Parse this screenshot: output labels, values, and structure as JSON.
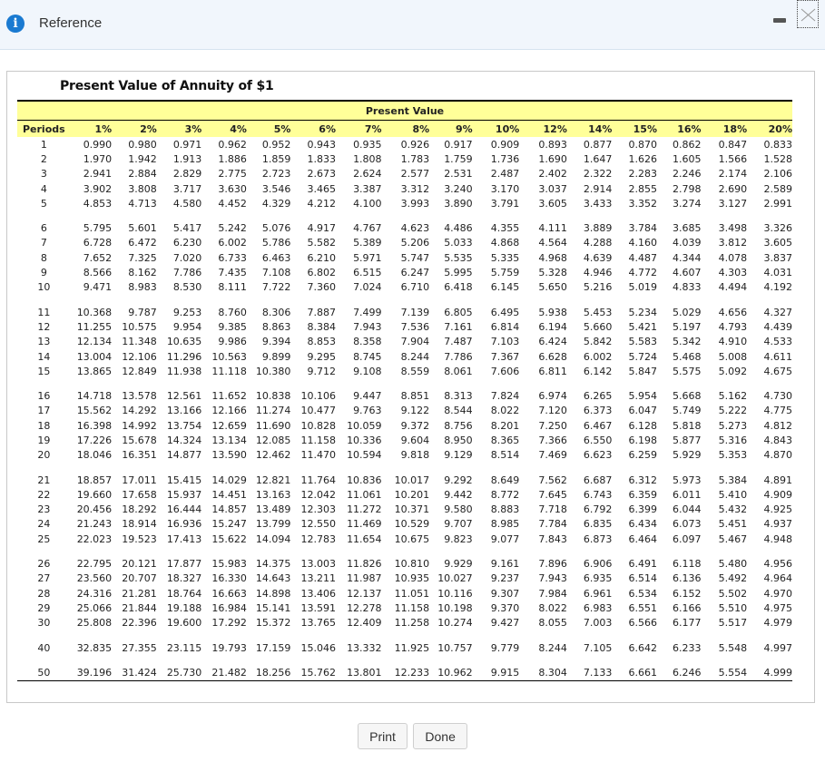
{
  "window": {
    "title": "Reference",
    "icons": {
      "info": "info-icon",
      "minimize": "minimize-icon",
      "close": "close-icon"
    }
  },
  "panel": {
    "title": "Present Value of Annuity of $1",
    "banner": "Present Value"
  },
  "table": {
    "headers": [
      "Periods",
      "1%",
      "2%",
      "3%",
      "4%",
      "5%",
      "6%",
      "7%",
      "8%",
      "9%",
      "10%",
      "12%",
      "14%",
      "15%",
      "16%",
      "18%",
      "20%"
    ],
    "groups": [
      [
        [
          "1",
          "0.990",
          "0.980",
          "0.971",
          "0.962",
          "0.952",
          "0.943",
          "0.935",
          "0.926",
          "0.917",
          "0.909",
          "0.893",
          "0.877",
          "0.870",
          "0.862",
          "0.847",
          "0.833"
        ],
        [
          "2",
          "1.970",
          "1.942",
          "1.913",
          "1.886",
          "1.859",
          "1.833",
          "1.808",
          "1.783",
          "1.759",
          "1.736",
          "1.690",
          "1.647",
          "1.626",
          "1.605",
          "1.566",
          "1.528"
        ],
        [
          "3",
          "2.941",
          "2.884",
          "2.829",
          "2.775",
          "2.723",
          "2.673",
          "2.624",
          "2.577",
          "2.531",
          "2.487",
          "2.402",
          "2.322",
          "2.283",
          "2.246",
          "2.174",
          "2.106"
        ],
        [
          "4",
          "3.902",
          "3.808",
          "3.717",
          "3.630",
          "3.546",
          "3.465",
          "3.387",
          "3.312",
          "3.240",
          "3.170",
          "3.037",
          "2.914",
          "2.855",
          "2.798",
          "2.690",
          "2.589"
        ],
        [
          "5",
          "4.853",
          "4.713",
          "4.580",
          "4.452",
          "4.329",
          "4.212",
          "4.100",
          "3.993",
          "3.890",
          "3.791",
          "3.605",
          "3.433",
          "3.352",
          "3.274",
          "3.127",
          "2.991"
        ]
      ],
      [
        [
          "6",
          "5.795",
          "5.601",
          "5.417",
          "5.242",
          "5.076",
          "4.917",
          "4.767",
          "4.623",
          "4.486",
          "4.355",
          "4.111",
          "3.889",
          "3.784",
          "3.685",
          "3.498",
          "3.326"
        ],
        [
          "7",
          "6.728",
          "6.472",
          "6.230",
          "6.002",
          "5.786",
          "5.582",
          "5.389",
          "5.206",
          "5.033",
          "4.868",
          "4.564",
          "4.288",
          "4.160",
          "4.039",
          "3.812",
          "3.605"
        ],
        [
          "8",
          "7.652",
          "7.325",
          "7.020",
          "6.733",
          "6.463",
          "6.210",
          "5.971",
          "5.747",
          "5.535",
          "5.335",
          "4.968",
          "4.639",
          "4.487",
          "4.344",
          "4.078",
          "3.837"
        ],
        [
          "9",
          "8.566",
          "8.162",
          "7.786",
          "7.435",
          "7.108",
          "6.802",
          "6.515",
          "6.247",
          "5.995",
          "5.759",
          "5.328",
          "4.946",
          "4.772",
          "4.607",
          "4.303",
          "4.031"
        ],
        [
          "10",
          "9.471",
          "8.983",
          "8.530",
          "8.111",
          "7.722",
          "7.360",
          "7.024",
          "6.710",
          "6.418",
          "6.145",
          "5.650",
          "5.216",
          "5.019",
          "4.833",
          "4.494",
          "4.192"
        ]
      ],
      [
        [
          "11",
          "10.368",
          "9.787",
          "9.253",
          "8.760",
          "8.306",
          "7.887",
          "7.499",
          "7.139",
          "6.805",
          "6.495",
          "5.938",
          "5.453",
          "5.234",
          "5.029",
          "4.656",
          "4.327"
        ],
        [
          "12",
          "11.255",
          "10.575",
          "9.954",
          "9.385",
          "8.863",
          "8.384",
          "7.943",
          "7.536",
          "7.161",
          "6.814",
          "6.194",
          "5.660",
          "5.421",
          "5.197",
          "4.793",
          "4.439"
        ],
        [
          "13",
          "12.134",
          "11.348",
          "10.635",
          "9.986",
          "9.394",
          "8.853",
          "8.358",
          "7.904",
          "7.487",
          "7.103",
          "6.424",
          "5.842",
          "5.583",
          "5.342",
          "4.910",
          "4.533"
        ],
        [
          "14",
          "13.004",
          "12.106",
          "11.296",
          "10.563",
          "9.899",
          "9.295",
          "8.745",
          "8.244",
          "7.786",
          "7.367",
          "6.628",
          "6.002",
          "5.724",
          "5.468",
          "5.008",
          "4.611"
        ],
        [
          "15",
          "13.865",
          "12.849",
          "11.938",
          "11.118",
          "10.380",
          "9.712",
          "9.108",
          "8.559",
          "8.061",
          "7.606",
          "6.811",
          "6.142",
          "5.847",
          "5.575",
          "5.092",
          "4.675"
        ]
      ],
      [
        [
          "16",
          "14.718",
          "13.578",
          "12.561",
          "11.652",
          "10.838",
          "10.106",
          "9.447",
          "8.851",
          "8.313",
          "7.824",
          "6.974",
          "6.265",
          "5.954",
          "5.668",
          "5.162",
          "4.730"
        ],
        [
          "17",
          "15.562",
          "14.292",
          "13.166",
          "12.166",
          "11.274",
          "10.477",
          "9.763",
          "9.122",
          "8.544",
          "8.022",
          "7.120",
          "6.373",
          "6.047",
          "5.749",
          "5.222",
          "4.775"
        ],
        [
          "18",
          "16.398",
          "14.992",
          "13.754",
          "12.659",
          "11.690",
          "10.828",
          "10.059",
          "9.372",
          "8.756",
          "8.201",
          "7.250",
          "6.467",
          "6.128",
          "5.818",
          "5.273",
          "4.812"
        ],
        [
          "19",
          "17.226",
          "15.678",
          "14.324",
          "13.134",
          "12.085",
          "11.158",
          "10.336",
          "9.604",
          "8.950",
          "8.365",
          "7.366",
          "6.550",
          "6.198",
          "5.877",
          "5.316",
          "4.843"
        ],
        [
          "20",
          "18.046",
          "16.351",
          "14.877",
          "13.590",
          "12.462",
          "11.470",
          "10.594",
          "9.818",
          "9.129",
          "8.514",
          "7.469",
          "6.623",
          "6.259",
          "5.929",
          "5.353",
          "4.870"
        ]
      ],
      [
        [
          "21",
          "18.857",
          "17.011",
          "15.415",
          "14.029",
          "12.821",
          "11.764",
          "10.836",
          "10.017",
          "9.292",
          "8.649",
          "7.562",
          "6.687",
          "6.312",
          "5.973",
          "5.384",
          "4.891"
        ],
        [
          "22",
          "19.660",
          "17.658",
          "15.937",
          "14.451",
          "13.163",
          "12.042",
          "11.061",
          "10.201",
          "9.442",
          "8.772",
          "7.645",
          "6.743",
          "6.359",
          "6.011",
          "5.410",
          "4.909"
        ],
        [
          "23",
          "20.456",
          "18.292",
          "16.444",
          "14.857",
          "13.489",
          "12.303",
          "11.272",
          "10.371",
          "9.580",
          "8.883",
          "7.718",
          "6.792",
          "6.399",
          "6.044",
          "5.432",
          "4.925"
        ],
        [
          "24",
          "21.243",
          "18.914",
          "16.936",
          "15.247",
          "13.799",
          "12.550",
          "11.469",
          "10.529",
          "9.707",
          "8.985",
          "7.784",
          "6.835",
          "6.434",
          "6.073",
          "5.451",
          "4.937"
        ],
        [
          "25",
          "22.023",
          "19.523",
          "17.413",
          "15.622",
          "14.094",
          "12.783",
          "11.654",
          "10.675",
          "9.823",
          "9.077",
          "7.843",
          "6.873",
          "6.464",
          "6.097",
          "5.467",
          "4.948"
        ]
      ],
      [
        [
          "26",
          "22.795",
          "20.121",
          "17.877",
          "15.983",
          "14.375",
          "13.003",
          "11.826",
          "10.810",
          "9.929",
          "9.161",
          "7.896",
          "6.906",
          "6.491",
          "6.118",
          "5.480",
          "4.956"
        ],
        [
          "27",
          "23.560",
          "20.707",
          "18.327",
          "16.330",
          "14.643",
          "13.211",
          "11.987",
          "10.935",
          "10.027",
          "9.237",
          "7.943",
          "6.935",
          "6.514",
          "6.136",
          "5.492",
          "4.964"
        ],
        [
          "28",
          "24.316",
          "21.281",
          "18.764",
          "16.663",
          "14.898",
          "13.406",
          "12.137",
          "11.051",
          "10.116",
          "9.307",
          "7.984",
          "6.961",
          "6.534",
          "6.152",
          "5.502",
          "4.970"
        ],
        [
          "29",
          "25.066",
          "21.844",
          "19.188",
          "16.984",
          "15.141",
          "13.591",
          "12.278",
          "11.158",
          "10.198",
          "9.370",
          "8.022",
          "6.983",
          "6.551",
          "6.166",
          "5.510",
          "4.975"
        ],
        [
          "30",
          "25.808",
          "22.396",
          "19.600",
          "17.292",
          "15.372",
          "13.765",
          "12.409",
          "11.258",
          "10.274",
          "9.427",
          "8.055",
          "7.003",
          "6.566",
          "6.177",
          "5.517",
          "4.979"
        ]
      ],
      [
        [
          "40",
          "32.835",
          "27.355",
          "23.115",
          "19.793",
          "17.159",
          "15.046",
          "13.332",
          "11.925",
          "10.757",
          "9.779",
          "8.244",
          "7.105",
          "6.642",
          "6.233",
          "5.548",
          "4.997"
        ]
      ],
      [
        [
          "50",
          "39.196",
          "31.424",
          "25.730",
          "21.482",
          "18.256",
          "15.762",
          "13.801",
          "12.233",
          "10.962",
          "9.915",
          "8.304",
          "7.133",
          "6.661",
          "6.246",
          "5.554",
          "4.999"
        ]
      ]
    ]
  },
  "buttons": {
    "print": "Print",
    "done": "Done"
  }
}
